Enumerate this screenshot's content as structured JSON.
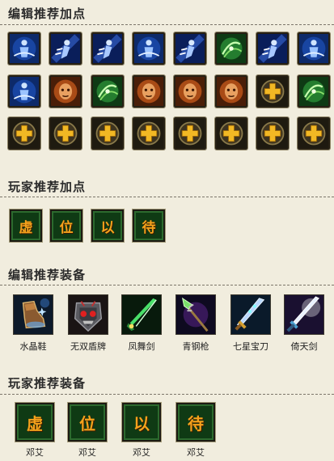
{
  "sections": {
    "editor_skill": "编辑推荐加点",
    "player_skill": "玩家推荐加点",
    "editor_equip": "编辑推荐装备",
    "player_equip": "玩家推荐装备"
  },
  "skill_rows": [
    [
      "blue-figure-icon",
      "blue-dash-icon",
      "blue-dash-icon",
      "blue-figure-icon",
      "blue-dash-icon",
      "green-swirl-icon",
      "blue-dash-icon",
      "blue-figure-icon"
    ],
    [
      "blue-figure-icon",
      "fire-face-icon",
      "green-swirl-icon",
      "fire-face-icon",
      "fire-face-icon",
      "fire-face-icon",
      "gold-cross-icon",
      "green-swirl-icon"
    ],
    [
      "gold-cross-icon",
      "gold-cross-icon",
      "gold-cross-icon",
      "gold-cross-icon",
      "gold-cross-icon",
      "gold-cross-icon",
      "gold-cross-icon",
      "gold-cross-icon"
    ]
  ],
  "placeholder_chars": [
    "虚",
    "位",
    "以",
    "待"
  ],
  "editor_equipment": [
    {
      "name": "水晶鞋",
      "icon": "crystal-boot-icon"
    },
    {
      "name": "无双盾牌",
      "icon": "demon-shield-icon"
    },
    {
      "name": "凤舞剑",
      "icon": "green-sword-icon"
    },
    {
      "name": "青钢枪",
      "icon": "green-spear-icon"
    },
    {
      "name": "七星宝刀",
      "icon": "star-blade-icon"
    },
    {
      "name": "倚天剑",
      "icon": "heaven-sword-icon"
    }
  ],
  "player_equipment": [
    {
      "char": "虚",
      "caption": "邓艾"
    },
    {
      "char": "位",
      "caption": "邓艾"
    },
    {
      "char": "以",
      "caption": "邓艾"
    },
    {
      "char": "待",
      "caption": "邓艾"
    }
  ],
  "colors": {
    "background": "#f1edde",
    "placeholder_bg": "#0f3a14",
    "placeholder_text": "#f5a21c"
  }
}
